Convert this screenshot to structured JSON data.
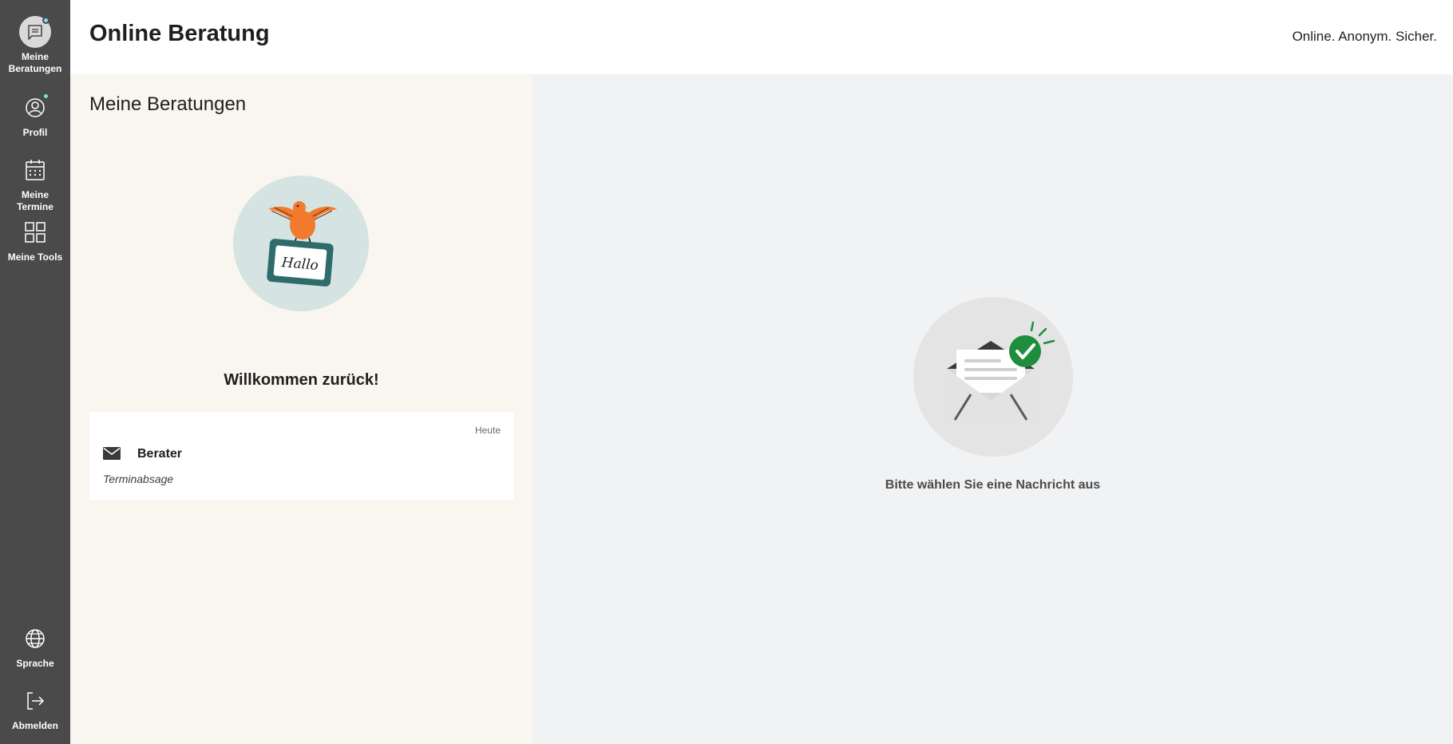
{
  "nav": {
    "items": [
      {
        "label_line1": "Meine",
        "label_line2": "Beratungen",
        "icon": "chat-icon",
        "active": true,
        "badge": true
      },
      {
        "label": "Profil",
        "icon": "user-circle-icon",
        "badge": true
      },
      {
        "label": "Meine Termine",
        "icon": "calendar-icon"
      },
      {
        "label": "Meine Tools",
        "icon": "grid-icon"
      }
    ],
    "bottom": [
      {
        "label": "Sprache",
        "icon": "globe-icon"
      },
      {
        "label": "Abmelden",
        "icon": "logout-icon"
      }
    ]
  },
  "header": {
    "title": "Online Beratung",
    "claim": "Online. Anonym. Sicher."
  },
  "list": {
    "title": "Meine Beratungen",
    "welcome": "Willkommen zurück!",
    "welcome_sign": "Hallo",
    "sessions": [
      {
        "date": "Heute",
        "name": "Berater",
        "subject": "Terminabsage"
      }
    ]
  },
  "detail": {
    "empty_text": "Bitte wählen Sie eine Nachricht aus"
  },
  "colors": {
    "sidebar": "#4a4a4a",
    "badge": "#80deea",
    "list_bg": "#f9f6ef",
    "detail_bg": "#f1f2f4",
    "accent_green": "#1e8e3e",
    "bird_orange": "#f27a2e"
  }
}
